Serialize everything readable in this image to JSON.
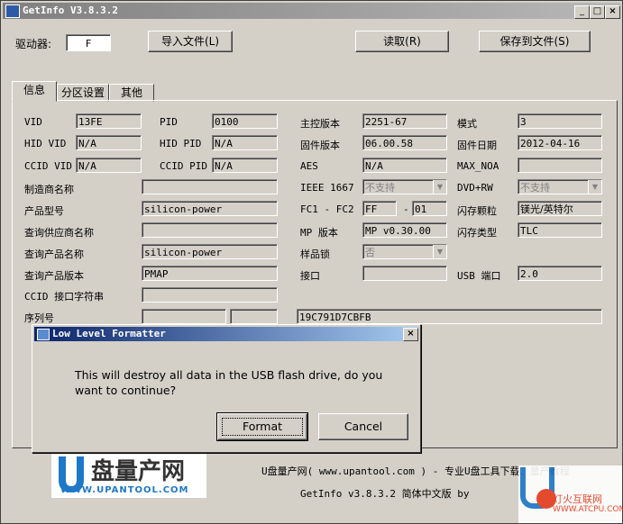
{
  "app": {
    "title": "GetInfo V3.8.3.2"
  },
  "toolbar": {
    "drive_label": "驱动器:",
    "drive_value": "F",
    "import_label": "导入文件(L)",
    "read_label": "读取(R)",
    "save_label": "保存到文件(S)"
  },
  "tabs": [
    {
      "label": "信息",
      "active": true
    },
    {
      "label": "分区设置",
      "active": false
    },
    {
      "label": "其他",
      "active": false
    }
  ],
  "fields": {
    "vid": {
      "label": "VID",
      "value": "13FE"
    },
    "pid": {
      "label": "PID",
      "value": "0100"
    },
    "controller_ver": {
      "label": "主控版本",
      "value": "2251-67"
    },
    "mode": {
      "label": "模式",
      "value": "3"
    },
    "hid_vid": {
      "label": "HID VID",
      "value": "N/A"
    },
    "hid_pid": {
      "label": "HID PID",
      "value": "N/A"
    },
    "firmware_ver": {
      "label": "固件版本",
      "value": "06.00.58"
    },
    "firmware_date": {
      "label": "固件日期",
      "value": "2012-04-16"
    },
    "ccid_vid": {
      "label": "CCID VID",
      "value": "N/A"
    },
    "ccid_pid": {
      "label": "CCID PID",
      "value": "N/A"
    },
    "aes": {
      "label": "AES",
      "value": "N/A"
    },
    "max_noa": {
      "label": "MAX_NOA",
      "value": ""
    },
    "manufacturer": {
      "label": "制造商名称",
      "value": ""
    },
    "ieee1667": {
      "label": "IEEE 1667",
      "value": "不支持"
    },
    "dvd_rw": {
      "label": "DVD+RW",
      "value": "不支持"
    },
    "product_model": {
      "label": "产品型号",
      "value": "silicon-power"
    },
    "fc": {
      "label": "FC1 - FC2",
      "value1": "FF",
      "sep": "-",
      "value2": "01"
    },
    "flash_chip": {
      "label": "闪存颗粒",
      "value": "镁光/英特尔"
    },
    "query_vendor": {
      "label": "查询供应商名称",
      "value": ""
    },
    "mp_ver": {
      "label": "MP 版本",
      "value": "MP v0.30.00"
    },
    "flash_type": {
      "label": "闪存类型",
      "value": "TLC"
    },
    "query_product": {
      "label": "查询产品名称",
      "value": "silicon-power"
    },
    "sample_lock": {
      "label": "样品锁",
      "value": "否"
    },
    "query_product_ver": {
      "label": "查询产品版本",
      "value": "PMAP"
    },
    "interface": {
      "label": "接口",
      "value": ""
    },
    "usb_port": {
      "label": "USB 端口",
      "value": "2.0"
    },
    "ccid_str": {
      "label": "CCID 接口字符串",
      "value": ""
    },
    "serial": {
      "label": "序列号",
      "value": "19C791D7CBFB"
    }
  },
  "dialog": {
    "title": "Low Level Formatter",
    "message": "This will destroy all data in the USB flash drive, do you want to continue?",
    "format_label": "Format",
    "cancel_label": "Cancel"
  },
  "footer": {
    "line1": "U盘量产网( www.upantool.com ) - 专业U盘工具下载、量产教程",
    "line2": "GetInfo v3.8.3.2 简体中文版 by"
  },
  "logo": {
    "brand": "盘量产网",
    "url": "WWW.UPANTOOL.COM"
  },
  "watermark": {
    "text": "灯火互联网",
    "url": "WWW.ATCPU.COM"
  },
  "colors": {
    "dialog_title": "#0a246a",
    "inactive_title": "#808080",
    "face": "#d4d0c8"
  }
}
